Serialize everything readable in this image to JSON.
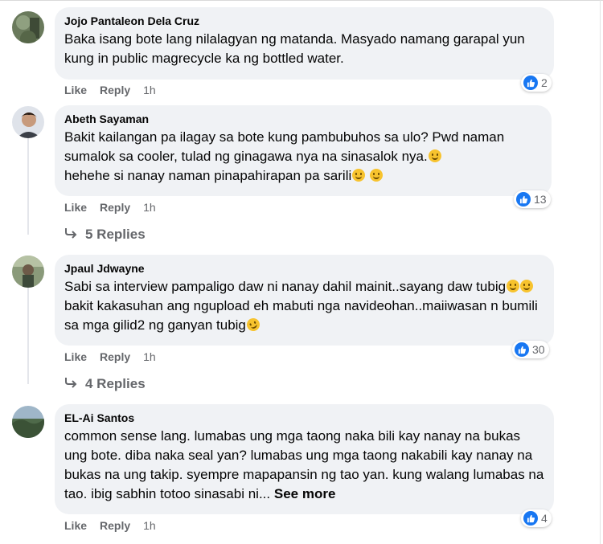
{
  "comments": [
    {
      "author": "Jojo Pantaleon Dela Cruz",
      "text": "Baka isang bote lang nilalagyan ng matanda. Masyado namang garapal yun kung in public magrecycle ka ng bottled water.",
      "reactions": "2",
      "like_label": "Like",
      "reply_label": "Reply",
      "time": "1h"
    },
    {
      "author": "Abeth Sayaman",
      "text_a": "Bakit kailangan pa ilagay sa bote kung pambubuhos sa ulo? Pwd naman sumalok sa cooler, tulad ng ginagawa nya na sinasalok nya.",
      "text_b": "hehehe si nanay naman pinapahirapan pa sarili",
      "reactions": "13",
      "like_label": "Like",
      "reply_label": "Reply",
      "time": "1h",
      "replies_label": "5 Replies"
    },
    {
      "author": "Jpaul Jdwayne",
      "text_a": "Sabi sa interview pampaligo daw ni nanay dahil mainit..sayang daw tubig",
      "text_b": "bakit kakasuhan ang ngupload eh mabuti nga navideohan..maiiwasan n bumili sa mga gilid2 ng ganyan tubig",
      "reactions": "30",
      "like_label": "Like",
      "reply_label": "Reply",
      "time": "1h",
      "replies_label": "4 Replies"
    },
    {
      "author": "EL-Ai Santos",
      "text": "common sense lang. lumabas ung mga taong naka bili kay nanay na bukas ung bote. diba naka seal yan? lumabas ung mga taong nakabili kay nanay na bukas na ung takip. syempre mapapansin ng tao yan. kung walang lumabas na tao. ibig sabhin totoo sinasabi ni...",
      "see_more": "See more",
      "reactions": "4",
      "like_label": "Like",
      "reply_label": "Reply",
      "time": "1h"
    }
  ],
  "colors": {
    "bubble": "#f0f2f5",
    "like_blue": "#1877f2",
    "meta_gray": "#65676b"
  },
  "icons": {
    "like": "thumbs-up-icon",
    "reply": "reply-arrow-icon",
    "emoji": "grinning-sweat-emoji"
  }
}
